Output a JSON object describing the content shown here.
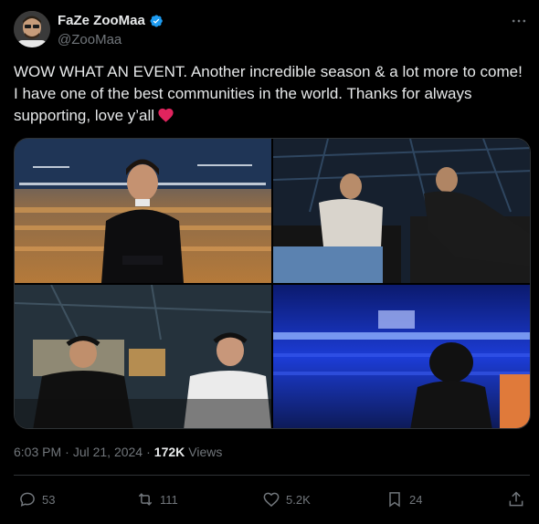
{
  "user": {
    "display_name": "FaZe ZooMaa",
    "handle": "@ZooMaa",
    "verified_color": "#1d9bf0"
  },
  "tweet": {
    "text": "WOW WHAT AN EVENT. Another incredible season & a lot more to come! I have one of the best communities in the world. Thanks for always supporting, love y’all",
    "emoji": "heart-icon"
  },
  "meta": {
    "time": "6:03 PM",
    "separator": "·",
    "date": "Jul 21, 2024",
    "separator2": "·",
    "views_count": "172K",
    "views_label": "Views"
  },
  "actions": {
    "replies": "53",
    "reposts": "111",
    "likes": "5.2K",
    "bookmarks": "24"
  },
  "colors": {
    "background": "#000000",
    "text": "#e7e9ea",
    "muted": "#71767b",
    "border": "#2f3336",
    "accent": "#1d9bf0",
    "heart": "#e0245e"
  }
}
